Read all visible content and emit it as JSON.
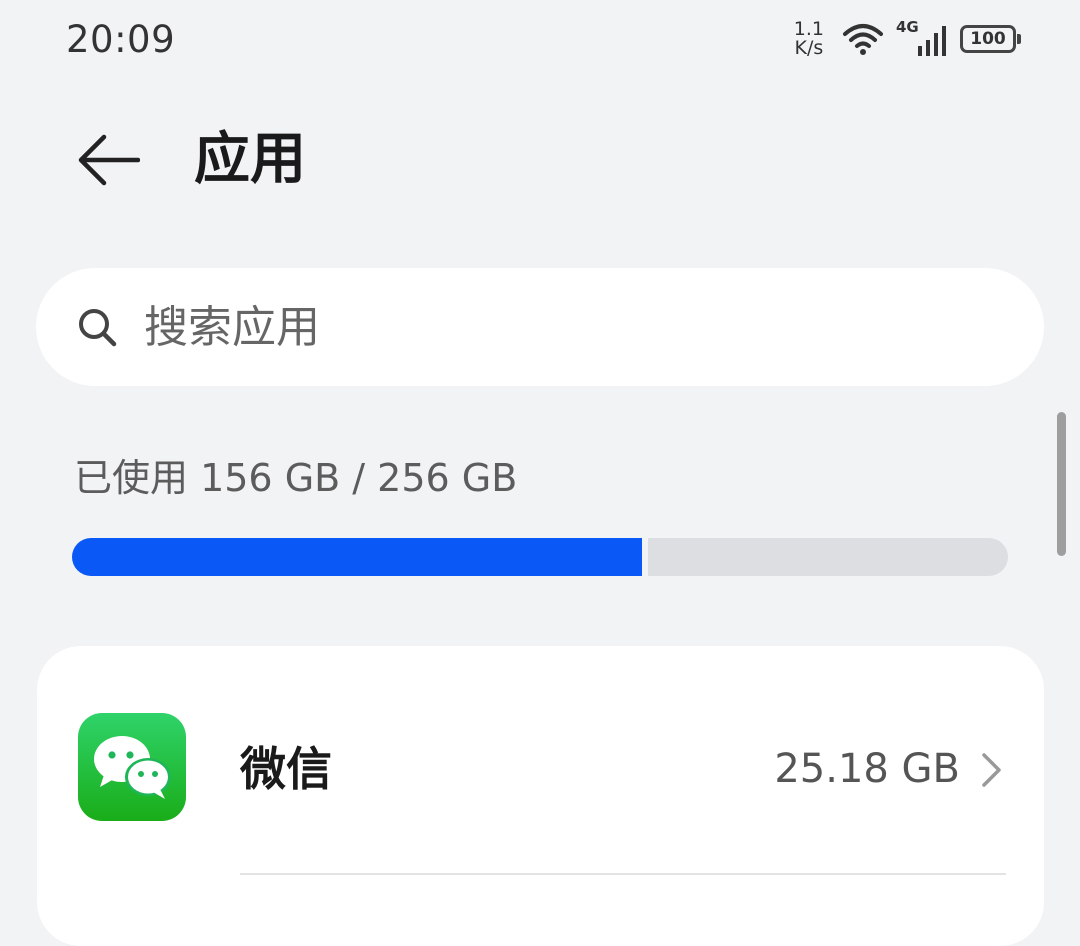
{
  "status_bar": {
    "time": "20:09",
    "net_speed_value": "1.1",
    "net_speed_unit": "K/s",
    "network_type": "4G",
    "battery": "100"
  },
  "header": {
    "title": "应用"
  },
  "search": {
    "placeholder": "搜索应用"
  },
  "storage": {
    "label": "已使用 156 GB / 256 GB",
    "used_gb": 156,
    "total_gb": 256,
    "bar_color": "#0a59f7"
  },
  "apps": [
    {
      "name": "微信",
      "size": "25.18 GB",
      "icon": "wechat-icon",
      "icon_color": "#1aad19"
    }
  ]
}
